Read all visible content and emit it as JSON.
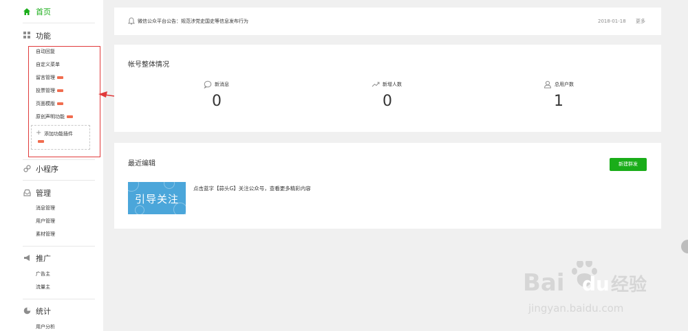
{
  "sidebar": {
    "home": {
      "label": "首页",
      "icon": "home-icon"
    },
    "features": {
      "label": "功能",
      "icon": "grid-icon",
      "items": [
        {
          "label": "自动回复",
          "new": false
        },
        {
          "label": "自定义菜单",
          "new": false
        },
        {
          "label": "留言管理",
          "new": true
        },
        {
          "label": "投票管理",
          "new": true
        },
        {
          "label": "页面模版",
          "new": true
        },
        {
          "label": "原创声明功能",
          "new": true
        }
      ],
      "add_plugin": {
        "label": "添加功能插件",
        "new": true
      }
    },
    "mini_program": {
      "label": "小程序",
      "icon": "link-icon"
    },
    "manage": {
      "label": "管理",
      "icon": "inbox-icon",
      "items": [
        "消息管理",
        "用户管理",
        "素材管理"
      ]
    },
    "promote": {
      "label": "推广",
      "icon": "megaphone-icon",
      "items": [
        "广告主",
        "流量主"
      ]
    },
    "stats": {
      "label": "统计",
      "icon": "pie-chart-icon",
      "items": [
        "用户分析"
      ]
    }
  },
  "notice": {
    "text": "微信公众平台公告：规范涉党史国史等信息发布行为",
    "date": "2018-01-18",
    "more": "更多"
  },
  "overview": {
    "title": "帐号整体情况",
    "stats": [
      {
        "label": "新消息",
        "value": "0",
        "icon": "message-bubble-icon"
      },
      {
        "label": "新增人数",
        "value": "0",
        "icon": "trend-up-icon"
      },
      {
        "label": "总用户数",
        "value": "1",
        "icon": "user-icon"
      }
    ]
  },
  "recent": {
    "title": "最近编辑",
    "new_button": "新建群发",
    "article": {
      "thumbnail_text": "引导关注",
      "title": "点击蓝字【蒜头G】关注公众号，查看更多精彩内容"
    }
  },
  "watermark": {
    "brand": "Bai du 经验",
    "url": "jingyan.baidu.com"
  },
  "colors": {
    "accent": "#1aad19",
    "highlight": "#e0393a",
    "new_tag": "#f16d4f",
    "thumbnail_bg": "#4ba6da"
  }
}
